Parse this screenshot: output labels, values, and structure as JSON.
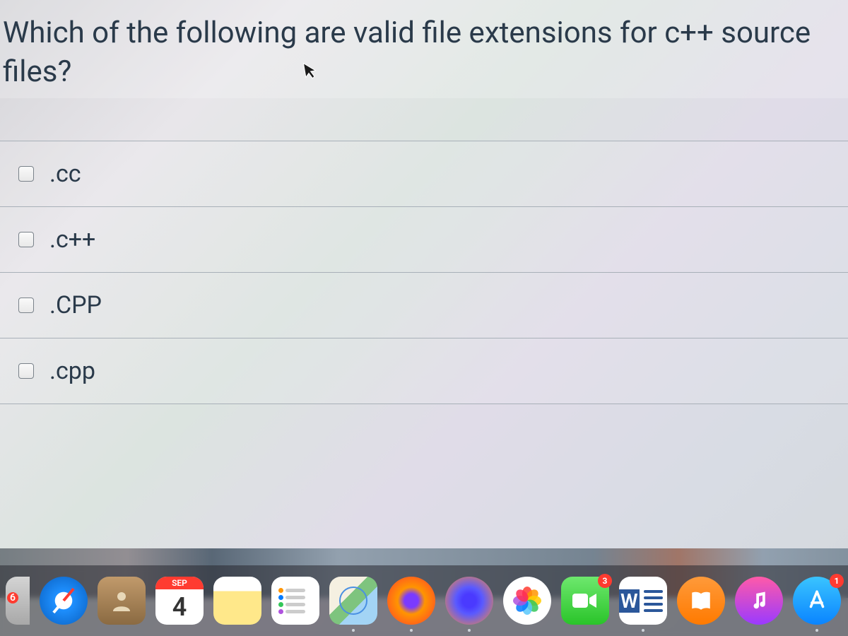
{
  "question": {
    "text": "Which of the following are valid file extensions for c++ source files?"
  },
  "options": [
    {
      "label": ".cc",
      "checked": false
    },
    {
      "label": ".c++",
      "checked": false
    },
    {
      "label": ".CPP",
      "checked": false
    },
    {
      "label": ".cpp",
      "checked": false
    }
  ],
  "dock": {
    "left_trimmed_badge": "6",
    "calendar": {
      "month": "SEP",
      "day": "4"
    },
    "facetime_badge": "3",
    "appstore_badge": "1",
    "items": [
      {
        "name": "safari",
        "running": false
      },
      {
        "name": "contacts",
        "running": false
      },
      {
        "name": "calendar",
        "running": true
      },
      {
        "name": "notes",
        "running": false
      },
      {
        "name": "reminders",
        "running": false
      },
      {
        "name": "maps",
        "running": true
      },
      {
        "name": "firefox",
        "running": true
      },
      {
        "name": "firefox-dev",
        "running": true
      },
      {
        "name": "photos",
        "running": false
      },
      {
        "name": "facetime",
        "running": false
      },
      {
        "name": "word",
        "running": true
      },
      {
        "name": "books",
        "running": false
      },
      {
        "name": "music",
        "running": false
      },
      {
        "name": "appstore",
        "running": true
      },
      {
        "name": "settings",
        "running": false
      }
    ]
  }
}
